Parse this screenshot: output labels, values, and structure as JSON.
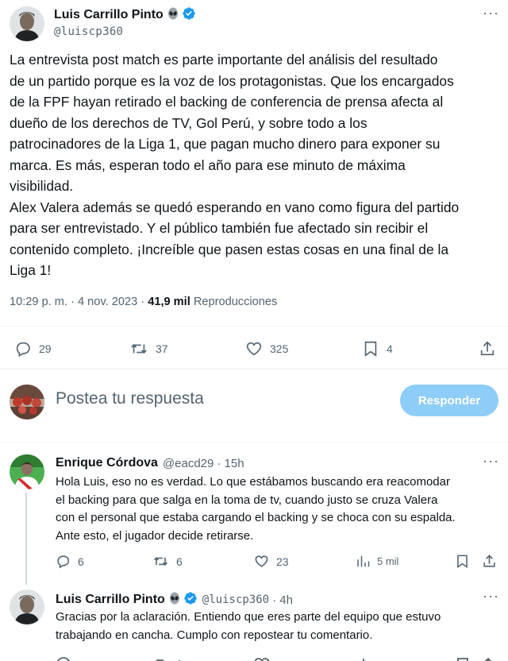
{
  "main_tweet": {
    "author_name": "Luis Carrillo Pinto",
    "author_handle": "@luiscp360",
    "text": "La entrevista post match es parte importante del análisis del resultado\nde un partido porque es la voz de los protagonistas. Que los encargados\nde la FPF hayan retirado el backing de conferencia de prensa afecta al\ndueño de los derechos de TV, Gol Perú, y sobre todo a los\npatrocinadores de la Liga 1, que pagan mucho dinero para exponer su\nmarca. Es más, esperan todo el año para ese minuto de máxima\nvisibilidad.\nAlex Valera además se quedó esperando en vano como figura del partido\npara ser entrevistado. Y el público también fue afectado sin recibir el\ncontenido completo. ¡Increíble que pasen estas cosas en una final de la\nLiga 1!",
    "time": "10:29 p. m.",
    "separator": "·",
    "date": "4 nov. 2023",
    "views_count": "41,9 mil",
    "views_label": "Reproducciones",
    "replies": "29",
    "retweets": "37",
    "likes": "325",
    "bookmarks": "4"
  },
  "composer": {
    "placeholder": "Postea tu respuesta",
    "button_label": "Responder"
  },
  "replies": [
    {
      "author_name": "Enrique Córdova",
      "author_handle": "@eacd29",
      "time": "· 15h",
      "text": "Hola Luis, eso no es verdad. Lo que estábamos buscando era reacomodar\nel backing para que salga en la toma de tv, cuando justo se cruza Valera\ncon el personal que estaba cargando el backing y se choca con su espalda.\nAnte esto, el jugador decide retirarse.",
      "replies": "6",
      "retweets": "6",
      "likes": "23",
      "views": "5 mil"
    },
    {
      "author_name": "Luis Carrillo Pinto",
      "author_handle": "@luiscp360",
      "time": "· 4h",
      "text": "Gracias por la aclaración. Entiendo que eres parte del equipo que estuvo\ntrabajando en cancha. Cumplo con repostear tu comentario."
    }
  ],
  "colors": {
    "accent": "#1d9bf0",
    "button_disabled": "#8ecdf8",
    "text_primary": "#0f1419",
    "text_secondary": "#536471",
    "divider": "#eff3f4"
  },
  "icons": [
    "verified-badge-icon",
    "alien-emoji-icon",
    "more-icon",
    "reply-icon",
    "retweet-icon",
    "like-icon",
    "bookmark-icon",
    "share-icon",
    "views-icon"
  ]
}
